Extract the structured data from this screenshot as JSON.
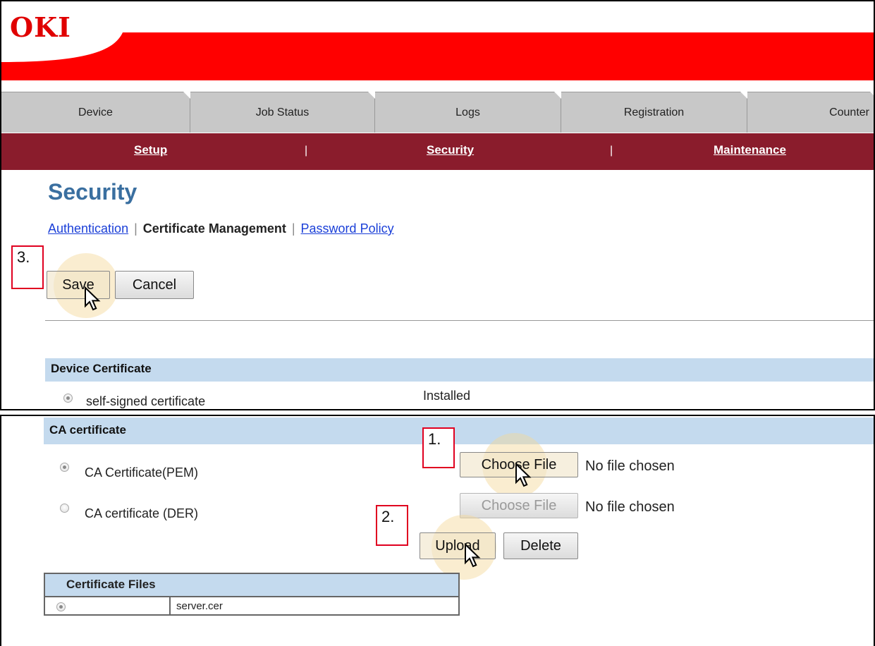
{
  "brand": {
    "logo_text": "OKI",
    "color": "#e00000"
  },
  "tabs": [
    {
      "label": "Device"
    },
    {
      "label": "Job Status"
    },
    {
      "label": "Logs"
    },
    {
      "label": "Registration"
    },
    {
      "label": "Counter"
    }
  ],
  "subnav": {
    "items": [
      "Setup",
      "Security",
      "Maintenance"
    ],
    "separator": "|"
  },
  "page": {
    "title": "Security"
  },
  "breadcrumb": {
    "link1": "Authentication",
    "current": "Certificate Management",
    "link2": "Password Policy",
    "separator": "|"
  },
  "actions": {
    "save": "Save",
    "cancel": "Cancel"
  },
  "steps": {
    "s1": "1.",
    "s2": "2.",
    "s3": "3."
  },
  "device_certificate": {
    "heading": "Device Certificate",
    "option": "self-signed certificate",
    "status": "Installed"
  },
  "ca_certificate": {
    "heading": "CA certificate",
    "pem_label": "CA Certificate(PEM)",
    "der_label": "CA certificate (DER)",
    "choose_file": "Choose File",
    "no_file": "No file chosen",
    "upload": "Upload",
    "delete": "Delete"
  },
  "certificate_files": {
    "header": "Certificate Files",
    "rows": [
      {
        "file": "server.cer"
      }
    ]
  }
}
